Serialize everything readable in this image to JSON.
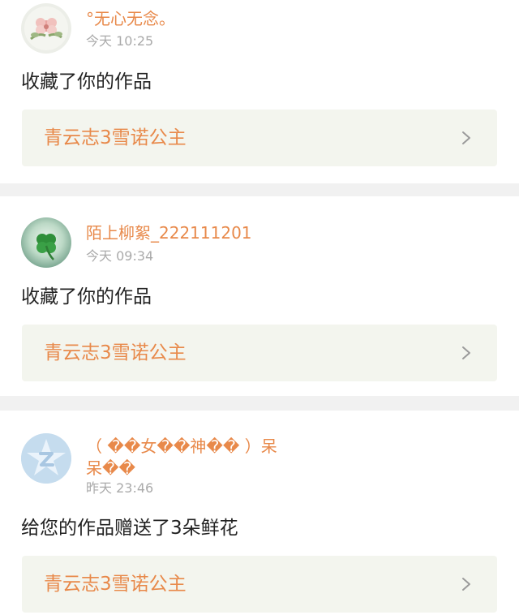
{
  "notifications": [
    {
      "avatar_icon": "flower-avatar-icon",
      "username": "°无心无念。",
      "time": "今天 10:25",
      "action": "收藏了你的作品",
      "work_title": "青云志3雪诺公主"
    },
    {
      "avatar_icon": "clover-avatar-icon",
      "username": "陌上柳絮_222111201",
      "time": "今天 09:34",
      "action": "收藏了你的作品",
      "work_title": "青云志3雪诺公主"
    },
    {
      "avatar_icon": "default-z-avatar-icon",
      "username": "（ ��女��神�� ）呆呆��",
      "time": "昨天 23:46",
      "action": "给您的作品赠送了3朵鲜花",
      "work_title": "青云志3雪诺公主"
    }
  ],
  "colors": {
    "accent": "#e8894a",
    "meta": "#aaaaaa",
    "work_box_bg": "#f3f5ee",
    "divider": "#f1f1f1"
  }
}
